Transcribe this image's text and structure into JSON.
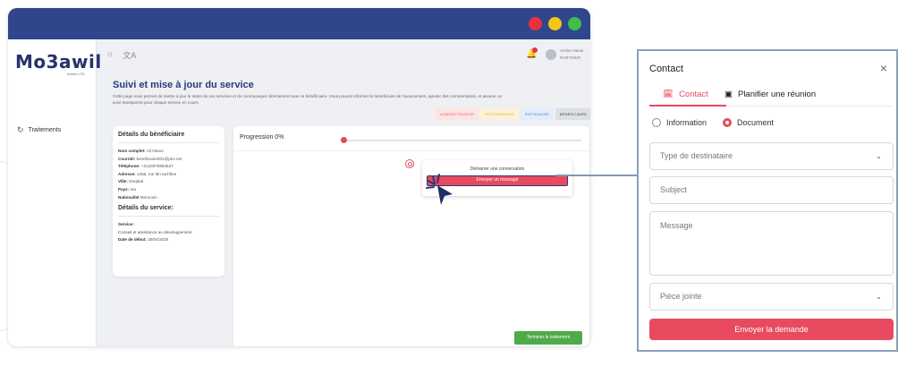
{
  "browser": {
    "logo": "Mo3awil",
    "logo_sub": "Annex LTD",
    "sidebar": {
      "items": [
        {
          "label": "Traitements"
        }
      ]
    },
    "top_icons": {
      "theme": "☼",
      "translate": "文A"
    },
    "user": {
      "name": "Amine Alaoui",
      "role": "PARTNER"
    },
    "page": {
      "title": "Suivi et mise à jour du service",
      "description": "Cette page vous permet de mettre à jour le statut de vos services et de communiquer directement avec le bénéficiaire. Vous pouvez informer le bénéficiaire de l'avancement, ajouter des commentaires, et assurer un suivi transparent pour chaque service en cours."
    },
    "role_tags": [
      "ADMINISTRATEUR",
      "GESTIONNAIRE",
      "PARTENAIRE",
      "BÉNÉFICIAIRE"
    ],
    "beneficiary": {
      "heading": "Détails du bénéficiaire",
      "fields": [
        {
          "label": "Nom complet:",
          "value": "Ali Alaoui"
        },
        {
          "label": "Courriel:",
          "value": "beneficiaire001@ptcr.net"
        },
        {
          "label": "Téléphone:",
          "value": "+2120679894537"
        },
        {
          "label": "Adresse:",
          "value": "1456, rue ibn tachfine"
        },
        {
          "label": "Ville:",
          "value": "tinejdad"
        },
        {
          "label": "Pays:",
          "value": "ma"
        },
        {
          "label": "Nationalité",
          "value": "Morocain"
        }
      ],
      "service_heading": "Détails du service:",
      "service_label": "Service:",
      "service_value": "Conseil et assistance au développement",
      "start_label": "Date de début:",
      "start_value": "30/04/2025"
    },
    "progress": {
      "label": "Progression 0%",
      "percent": 0
    },
    "conversation": {
      "title": "Démarrer une conversation",
      "button": "Envoyer un message"
    },
    "finish_button": "Terminer le traitement"
  },
  "contact_panel": {
    "title": "Contact",
    "close": "×",
    "tabs": [
      {
        "label": "Contact",
        "active": true
      },
      {
        "label": "Planifier une réunion",
        "active": false
      }
    ],
    "radios": [
      {
        "label": "Information",
        "checked": false
      },
      {
        "label": "Document",
        "checked": true
      }
    ],
    "recipient_type": "Type de destinataire",
    "subject": "Subject",
    "message": "Message",
    "attachment": "Pièce jointe",
    "submit": "Envoyer la demande"
  },
  "colors": {
    "accent": "#e84a5f",
    "navy": "#30468c",
    "success": "#4eab4a"
  }
}
